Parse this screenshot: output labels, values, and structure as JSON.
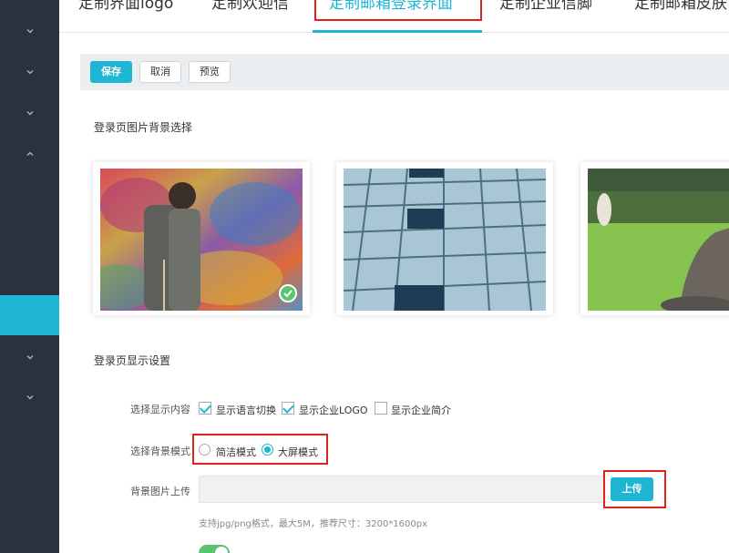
{
  "sidebar": {
    "items": [
      {
        "icon": "chevron-down-icon"
      },
      {
        "icon": "chevron-down-icon"
      },
      {
        "icon": "chevron-down-icon"
      },
      {
        "icon": "chevron-up-icon"
      },
      {
        "icon": "chevron-down-icon"
      },
      {
        "icon": "chevron-down-icon"
      }
    ],
    "active_color": "#1fb5d4",
    "bg_color": "#2c323d"
  },
  "tabs": [
    {
      "label": "定制界面logo",
      "active": false
    },
    {
      "label": "定制欢迎信",
      "active": false
    },
    {
      "label": "定制邮箱登录界面",
      "active": true
    },
    {
      "label": "定制企业信脚",
      "active": false
    },
    {
      "label": "定制邮箱皮肤",
      "active": false
    }
  ],
  "toolbar": {
    "save_label": "保存",
    "cancel_label": "取消",
    "preview_label": "预览"
  },
  "bg_select": {
    "title": "登录页图片背景选择",
    "images": [
      {
        "name": "graffiti-wall",
        "selected": true
      },
      {
        "name": "glass-building",
        "selected": false
      },
      {
        "name": "lawn-statue",
        "selected": false
      }
    ]
  },
  "display": {
    "title": "登录页显示设置",
    "content_label": "选择显示内容",
    "options": [
      {
        "label": "显示语言切换",
        "checked": true
      },
      {
        "label": "显示企业LOGO",
        "checked": true
      },
      {
        "label": "显示企业简介",
        "checked": false
      }
    ],
    "mode_label": "选择背景模式",
    "modes": [
      {
        "label": "简洁模式",
        "selected": false
      },
      {
        "label": "大屏模式",
        "selected": true
      }
    ],
    "upload_label": "背景图片上传",
    "upload_button": "上传",
    "upload_hint": "支持jpg/png格式，最大5M，推荐尺寸：3200*1600px",
    "toggle_on": true
  },
  "colors": {
    "accent": "#1fb5d4",
    "highlight": "#e0211c",
    "success": "#5cc36e"
  }
}
